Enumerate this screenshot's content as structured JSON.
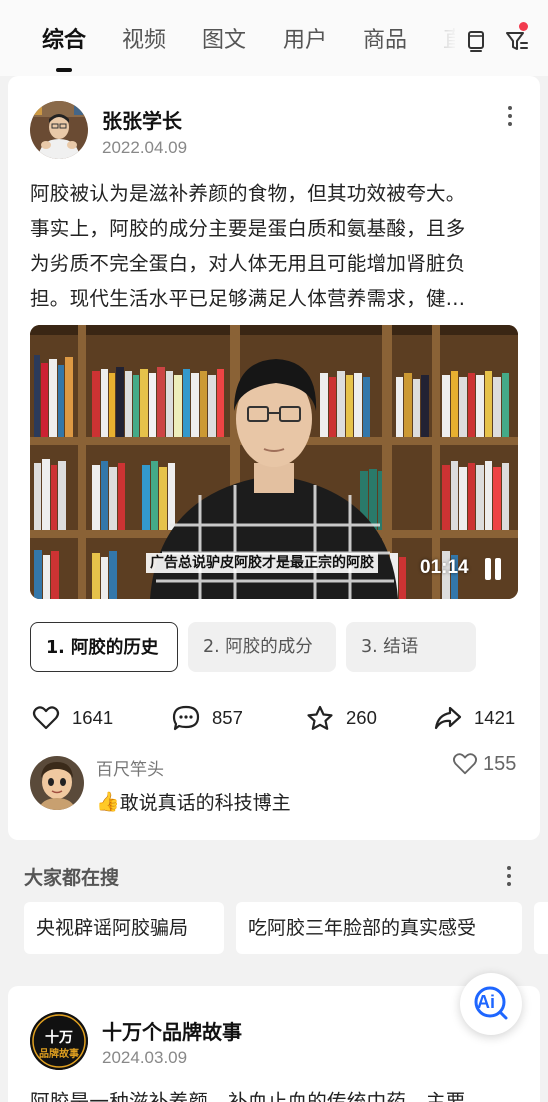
{
  "tabs": [
    {
      "label": "综合",
      "active": true
    },
    {
      "label": "视频",
      "active": false
    },
    {
      "label": "图文",
      "active": false
    },
    {
      "label": "用户",
      "active": false
    },
    {
      "label": "商品",
      "active": false
    },
    {
      "label": "直",
      "active": false
    }
  ],
  "top_icons": [
    "cast-screen-icon",
    "filter-icon"
  ],
  "post": {
    "author": "张张学长",
    "date": "2022.04.09",
    "text_lines": [
      "阿胶被认为是滋补养颜的食物，但其功效被夸大。",
      "事实上，阿胶的成分主要是蛋白质和氨基酸，且多",
      "为劣质不完全蛋白，对人体无用且可能增加肾脏负",
      "担。现代生活水平已足够满足人体营养需求，健..."
    ],
    "video": {
      "subtitle": "广告总说驴皮阿胶才是最正宗的阿胶",
      "time": "01:14"
    },
    "chapters": [
      "1. 阿胶的历史",
      "2. 阿胶的成分",
      "3. 结语"
    ],
    "stats": {
      "likes": "1641",
      "comments": "857",
      "favorites": "260",
      "shares": "1421"
    },
    "top_comment": {
      "user": "百尺竿头",
      "emoji": "👍",
      "text": "敢说真话的科技博主",
      "likes": "155"
    }
  },
  "search_section": {
    "title": "大家都在搜",
    "chips": [
      "央视辟谣阿胶骗局",
      "吃阿胶三年脸部的真实感受"
    ]
  },
  "post2": {
    "author": "十万个品牌故事",
    "date": "2024.03.09",
    "avatar_text": "十万品牌故事",
    "text_preview": "阿胶是一种滋补养颜、补血止血的传统中药，主要"
  },
  "ai_button": {
    "label": "Ai"
  },
  "colors": {
    "accent": "#f23b4e",
    "ai_blue": "#1e66ff"
  }
}
